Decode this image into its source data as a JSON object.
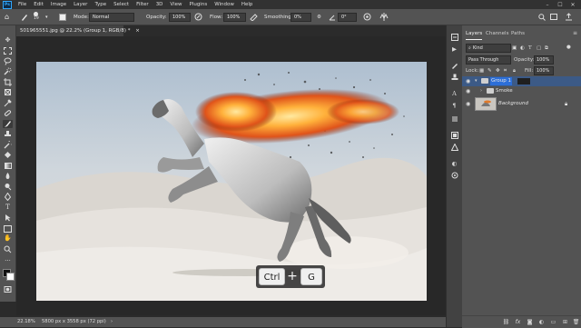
{
  "app": {
    "logo": "Ps"
  },
  "menu": [
    "File",
    "Edit",
    "Image",
    "Layer",
    "Type",
    "Select",
    "Filter",
    "3D",
    "View",
    "Plugins",
    "Window",
    "Help"
  ],
  "window_controls": {
    "minimize": "–",
    "maximize": "☐",
    "close": "✕"
  },
  "options_bar": {
    "brush_size": "19",
    "mode_label": "Mode:",
    "mode_value": "Normal",
    "opacity_label": "Opacity:",
    "opacity_value": "100%",
    "flow_label": "Flow:",
    "flow_value": "100%",
    "smoothing_label": "Smoothing:",
    "smoothing_value": "0%",
    "angle_value": "0°"
  },
  "document": {
    "tab_title": "501965551.jpg @ 22.2% (Group 1, RGB/8) *",
    "tab_close": "×"
  },
  "status_bar": {
    "zoom": "22.18%",
    "doc_info": "5800 px x 3558 px (72 ppi)"
  },
  "layers_panel": {
    "tabs": [
      "Layers",
      "Channels",
      "Paths"
    ],
    "active_tab": "Layers",
    "filter_kind": "Kind",
    "blend_mode": "Pass Through",
    "opacity_label": "Opacity:",
    "opacity_value": "100%",
    "lock_label": "Lock:",
    "fill_label": "Fill:",
    "fill_value": "100%",
    "layers": [
      {
        "name": "Group 1",
        "type": "group",
        "selected": true,
        "expanded": true
      },
      {
        "name": "Smoke",
        "type": "group",
        "selected": false,
        "expanded": false
      },
      {
        "name": "Background",
        "type": "image",
        "selected": false,
        "locked": true
      }
    ],
    "bottom_icons": [
      "link-icon",
      "fx-icon",
      "mask-icon",
      "adjustment-icon",
      "folder-icon",
      "new-layer-icon",
      "trash-icon"
    ],
    "fx_label": "fx"
  },
  "shortcut": {
    "key1": "Ctrl",
    "plus": "+",
    "key2": "G"
  },
  "colors": {
    "ui_dark": "#2b2b2b",
    "ui_panel": "#535353",
    "selection": "#3c5a86",
    "accent": "#31a8ff"
  }
}
